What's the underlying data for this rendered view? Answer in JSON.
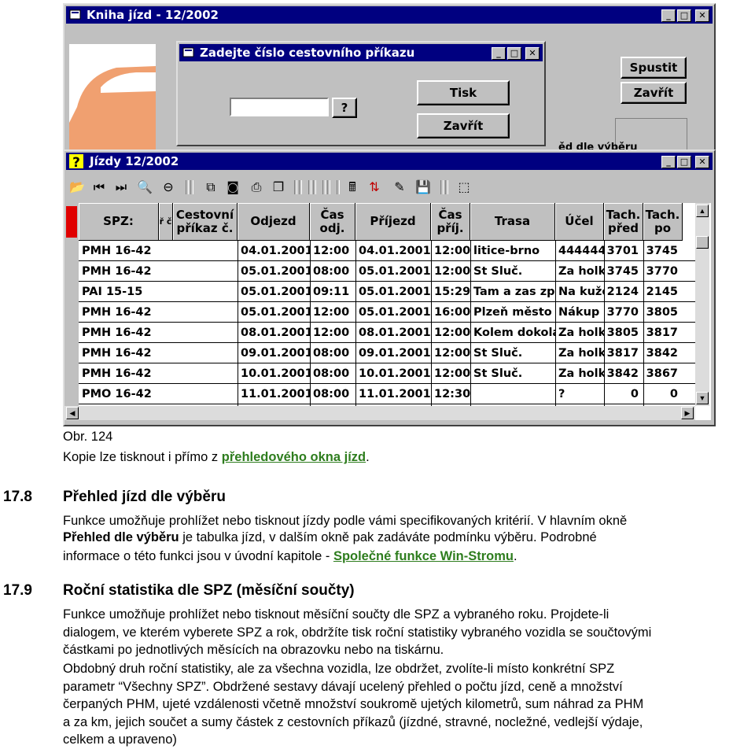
{
  "windows": {
    "kniha": {
      "title": "Kniha jízd - 12/2002",
      "spustit": "Spustit",
      "zavrit": "Zavřít",
      "partial_text": "ěd dle výběru"
    },
    "dialog": {
      "title": "Zadejte číslo cestovního příkazu",
      "input_value": "",
      "question_button": "?",
      "tisk_button": "Tisk",
      "zavrit_button": "Zavřít"
    },
    "jizdy": {
      "title": "Jízdy  12/2002",
      "columns": [
        "SPZ:",
        "ř č",
        "Cestovní příkaz č.",
        "Odjezd",
        "Čas odj.",
        "Příjezd",
        "Čas příj.",
        "Trasa",
        "Účel",
        "Tach. před",
        "Tach. po"
      ],
      "rows": [
        [
          "PMH 16-42",
          "",
          "",
          "04.01.2001",
          "12:00",
          "04.01.2001",
          "12:00",
          "litice-brno",
          "444444",
          "3701",
          "3745"
        ],
        [
          "PMH 16-42",
          "",
          "",
          "05.01.2001",
          "08:00",
          "05.01.2001",
          "12:00",
          "St Sluč.",
          "Za holk",
          "3745",
          "3770"
        ],
        [
          "PAI 15-15",
          "",
          "",
          "05.01.2001",
          "09:11",
          "05.01.2001",
          "15:29",
          "Tam a zas zpá",
          "Na kuže",
          "2124",
          "2145"
        ],
        [
          "PMH 16-42",
          "",
          "",
          "05.01.2001",
          "12:00",
          "05.01.2001",
          "16:00",
          "Plzeň město",
          "Nákup s",
          "3770",
          "3805"
        ],
        [
          "PMH 16-42",
          "",
          "",
          "08.01.2001",
          "12:00",
          "08.01.2001",
          "12:00",
          "Kolem dokola",
          "Za holk",
          "3805",
          "3817"
        ],
        [
          "PMH 16-42",
          "",
          "",
          "09.01.2001",
          "08:00",
          "09.01.2001",
          "12:00",
          "St Sluč.",
          "Za holk",
          "3817",
          "3842"
        ],
        [
          "PMH 16-42",
          "",
          "",
          "10.01.2001",
          "08:00",
          "10.01.2001",
          "12:00",
          "St Sluč.",
          "Za holk",
          "3842",
          "3867"
        ],
        [
          "PMO 16-42",
          "",
          "",
          "11.01.2001",
          "08:00",
          "11.01.2001",
          "12:30",
          "",
          "?",
          "0",
          "0"
        ]
      ]
    }
  },
  "doc": {
    "caption": "Obr. 124",
    "copy_text_before": "Kopie lze tisknout i přímo z ",
    "copy_link": "přehledového okna jízd",
    "copy_text_after": ".",
    "s1_num": "17.8",
    "s1_title": "Přehled jízd dle výběru",
    "s1_line1": "Funkce umožňuje prohlížet nebo tisknout jízdy podle vámi specifikovaných kritérií. V hlavním okně",
    "s1_line2_bold": "Přehled dle výběru",
    "s1_line2_rest": " je tabulka jízd, v dalším okně pak zadáváte podmínku výběru. Podrobné",
    "s1_line3_text": "informace o této funkci jsou v úvodní kapitole - ",
    "s1_line3_link": "Společné funkce Win-Stromu",
    "s1_line3_end": ".",
    "s2_num": "17.9",
    "s2_title": "Roční statistika dle SPZ (měsíční součty)",
    "s2_p1": [
      "Funkce umožňuje prohlížet nebo tisknout měsíční součty dle SPZ a vybraného roku. Projdete-li",
      "dialogem, ve kterém vyberete SPZ a rok, obdržíte tisk roční statistiky vybraného vozidla se součtovými",
      "částkami po jednotlivých měsících na obrazovku nebo na tiskárnu."
    ],
    "s2_p2": [
      "Obdobný druh roční statistiky, ale za všechna vozidla, lze obdržet, zvolíte-li místo konkrétní SPZ",
      "parametr “Všechny SPZ”. Obdržené sestavy dávají ucelený přehled o počtu jízd, ceně a množství",
      "čerpaných PHM, ujeté vzdálenosti včetně množství soukromě ujetých kilometrů, sum náhrad za PHM",
      "a za km, jejich součet a sumy částek z cestovních příkazů (jízdné, stravné, nocležné, vedlejší výdaje,",
      "celkem a upraveno)"
    ]
  }
}
